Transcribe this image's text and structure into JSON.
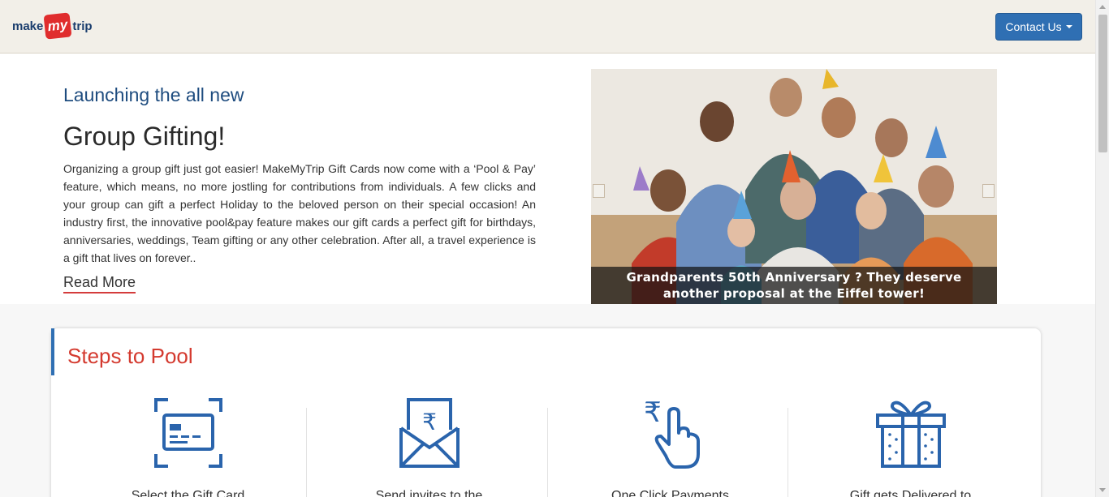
{
  "header": {
    "logo_make": "make",
    "logo_my": "my",
    "logo_trip": "trip",
    "contact_label": "Contact Us"
  },
  "hero": {
    "subtitle": "Launching the all new",
    "title": "Group Gifting!",
    "body": "Organizing a group gift just got easier! MakeMyTrip Gift Cards now come with a ‘Pool & Pay’ feature, which means, no more jostling for contributions from individuals. A few clicks and your group can gift a perfect Holiday to the beloved person on their special occasion! An industry first, the innovative pool&pay feature makes our gift cards a perfect gift for birthdays, anniversaries, weddings, Team gifting or any other celebration. After all, a travel experience is a gift that lives on forever..",
    "read_more": "Read More",
    "carousel_caption_line1": "Grandparents 50th Anniversary ? They deserve",
    "carousel_caption_line2": "another proposal at the Eiffel tower!"
  },
  "steps": {
    "title": "Steps to Pool",
    "items": [
      {
        "icon": "gift-card-scan-icon",
        "label": "Select the Gift Card"
      },
      {
        "icon": "rupee-envelope-icon",
        "label": "Send invites to the"
      },
      {
        "icon": "rupee-tap-icon",
        "label": "One Click Payments"
      },
      {
        "icon": "gift-box-icon",
        "label": "Gift gets Delivered to"
      }
    ]
  },
  "colors": {
    "header_bg": "#f2efe8",
    "accent_blue": "#2f6fb3",
    "accent_red": "#d43a2f",
    "icon_blue": "#2a64ac"
  }
}
